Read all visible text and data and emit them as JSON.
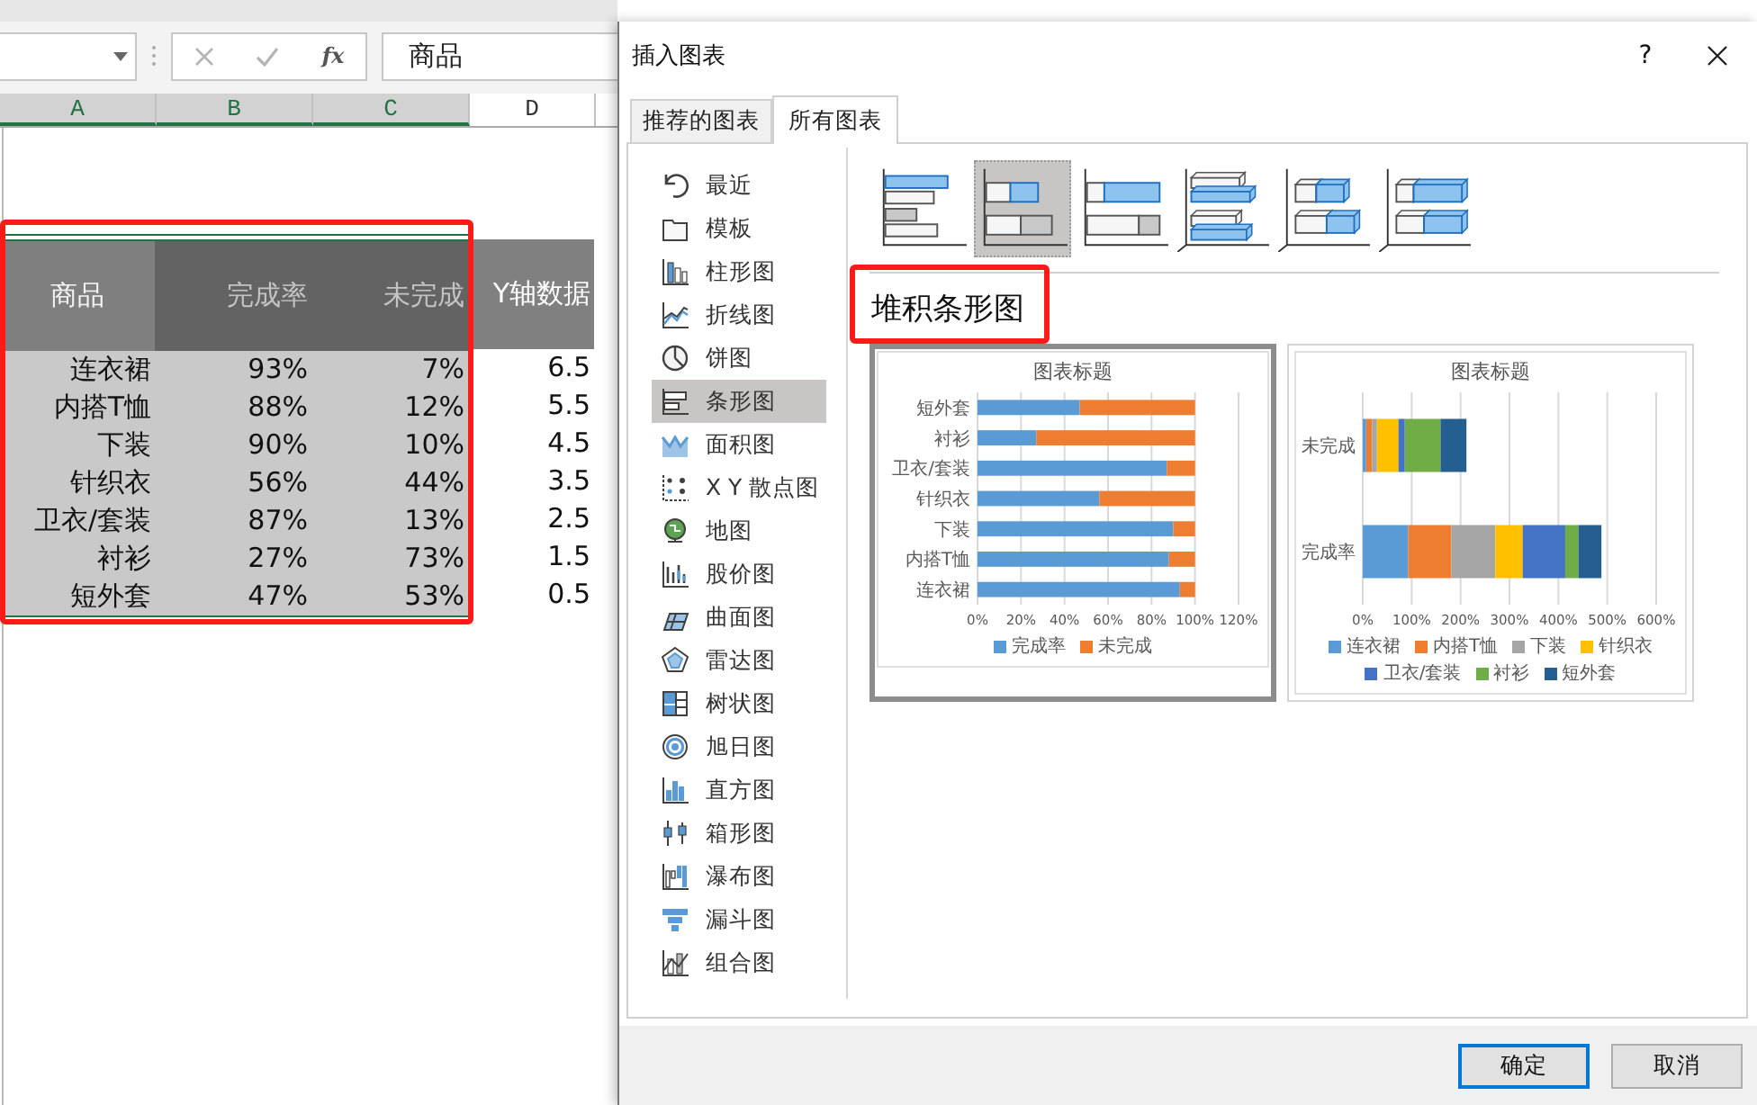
{
  "formula_bar": {
    "function_label": "fx",
    "value": "商品"
  },
  "columns": [
    {
      "label": "A",
      "selected": true
    },
    {
      "label": "B",
      "selected": true
    },
    {
      "label": "C",
      "selected": true
    },
    {
      "label": "D",
      "selected": false
    }
  ],
  "table": {
    "highlighted": true,
    "header": [
      "商品",
      "完成率",
      "未完成",
      "Y轴数据"
    ],
    "rows": [
      [
        "连衣裙",
        "93%",
        "7%",
        "6.5"
      ],
      [
        "内搭T恤",
        "88%",
        "12%",
        "5.5"
      ],
      [
        "下装",
        "90%",
        "10%",
        "4.5"
      ],
      [
        "针织衣",
        "56%",
        "44%",
        "3.5"
      ],
      [
        "卫衣/套装",
        "87%",
        "13%",
        "2.5"
      ],
      [
        "衬衫",
        "27%",
        "73%",
        "1.5"
      ],
      [
        "短外套",
        "47%",
        "53%",
        "0.5"
      ]
    ]
  },
  "dialog": {
    "title": "插入图表",
    "help": "?",
    "tabs": [
      {
        "label": "推荐的图表",
        "selected": false
      },
      {
        "label": "所有图表",
        "selected": true
      }
    ],
    "chart_types": [
      {
        "kind": "recent",
        "label": "最近",
        "selected": false
      },
      {
        "kind": "template",
        "label": "模板",
        "selected": false
      },
      {
        "kind": "column",
        "label": "柱形图",
        "selected": false
      },
      {
        "kind": "line",
        "label": "折线图",
        "selected": false
      },
      {
        "kind": "pie",
        "label": "饼图",
        "selected": false
      },
      {
        "kind": "bar",
        "label": "条形图",
        "selected": true
      },
      {
        "kind": "area",
        "label": "面积图",
        "selected": false
      },
      {
        "kind": "scatter",
        "label": "X Y 散点图",
        "selected": false
      },
      {
        "kind": "map",
        "label": "地图",
        "selected": false
      },
      {
        "kind": "stock",
        "label": "股价图",
        "selected": false
      },
      {
        "kind": "surface",
        "label": "曲面图",
        "selected": false
      },
      {
        "kind": "radar",
        "label": "雷达图",
        "selected": false
      },
      {
        "kind": "treemap",
        "label": "树状图",
        "selected": false
      },
      {
        "kind": "sunburst",
        "label": "旭日图",
        "selected": false
      },
      {
        "kind": "histogram",
        "label": "直方图",
        "selected": false
      },
      {
        "kind": "box",
        "label": "箱形图",
        "selected": false
      },
      {
        "kind": "waterfall",
        "label": "瀑布图",
        "selected": false
      },
      {
        "kind": "funnel",
        "label": "漏斗图",
        "selected": false
      },
      {
        "kind": "combo",
        "label": "组合图",
        "selected": false
      }
    ],
    "subtypes": [
      {
        "kind": "clustered",
        "selected": false
      },
      {
        "kind": "stacked",
        "selected": true
      },
      {
        "kind": "percent",
        "selected": false
      },
      {
        "kind": "clustered3d",
        "selected": false
      },
      {
        "kind": "stacked3d",
        "selected": false
      },
      {
        "kind": "percent3d",
        "selected": false
      }
    ],
    "subtype_title": {
      "text": "堆积条形图",
      "highlighted": true
    },
    "previews": [
      {
        "selected": true,
        "chart_data": {
          "type": "bar",
          "orientation": "horizontal",
          "stacked": true,
          "title": "图表标题",
          "grid": true,
          "legend": "bottom",
          "categories": [
            "短外套",
            "衬衫",
            "卫衣/套装",
            "针织衣",
            "下装",
            "内搭T恤",
            "连衣裙"
          ],
          "series": [
            {
              "name": "完成率",
              "color": "#5b9bd5",
              "values": [
                0.47,
                0.27,
                0.87,
                0.56,
                0.9,
                0.88,
                0.93
              ]
            },
            {
              "name": "未完成",
              "color": "#ed7d31",
              "values": [
                0.53,
                0.73,
                0.13,
                0.44,
                0.1,
                0.12,
                0.07
              ]
            }
          ],
          "xlim": [
            0,
            1.2
          ],
          "xticks": [
            {
              "value": 0,
              "label": "0%"
            },
            {
              "value": 0.2,
              "label": "20%"
            },
            {
              "value": 0.4,
              "label": "40%"
            },
            {
              "value": 0.6,
              "label": "60%"
            },
            {
              "value": 0.8,
              "label": "80%"
            },
            {
              "value": 1,
              "label": "100%"
            },
            {
              "value": 1.2,
              "label": "120%"
            }
          ]
        }
      },
      {
        "selected": false,
        "chart_data": {
          "type": "bar",
          "orientation": "horizontal",
          "stacked": true,
          "title": "图表标题",
          "grid": true,
          "legend": "bottom",
          "categories": [
            "未完成",
            "完成率"
          ],
          "series": [
            {
              "name": "连衣裙",
              "color": "#5b9bd5",
              "values": [
                0.07,
                0.93
              ]
            },
            {
              "name": "内搭T恤",
              "color": "#ed7d31",
              "values": [
                0.12,
                0.88
              ]
            },
            {
              "name": "下装",
              "color": "#a5a5a5",
              "values": [
                0.1,
                0.9
              ]
            },
            {
              "name": "针织衣",
              "color": "#ffc000",
              "values": [
                0.44,
                0.56
              ]
            },
            {
              "name": "卫衣/套装",
              "color": "#4472c4",
              "values": [
                0.13,
                0.87
              ]
            },
            {
              "name": "衬衫",
              "color": "#70ad47",
              "values": [
                0.73,
                0.27
              ]
            },
            {
              "name": "短外套",
              "color": "#255e91",
              "values": [
                0.53,
                0.47
              ]
            }
          ],
          "xlim": [
            0,
            6
          ],
          "xticks": [
            {
              "value": 0,
              "label": "0%"
            },
            {
              "value": 1,
              "label": "100%"
            },
            {
              "value": 2,
              "label": "200%"
            },
            {
              "value": 3,
              "label": "300%"
            },
            {
              "value": 4,
              "label": "400%"
            },
            {
              "value": 5,
              "label": "500%"
            },
            {
              "value": 6,
              "label": "600%"
            }
          ]
        }
      }
    ],
    "buttons": [
      {
        "label": "确定",
        "default": true
      },
      {
        "label": "取消",
        "default": false
      }
    ]
  }
}
